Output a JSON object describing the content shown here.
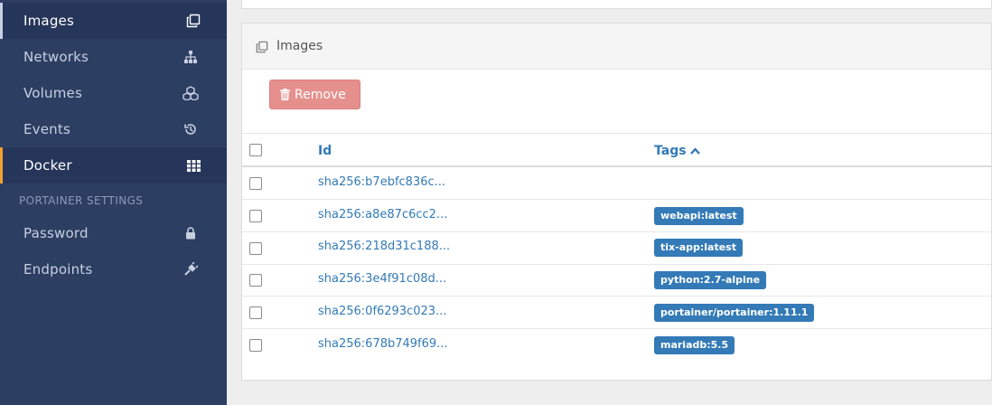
{
  "sidebar": {
    "items": [
      {
        "label": "Images",
        "icon": "clone-icon"
      },
      {
        "label": "Networks",
        "icon": "sitemap-icon"
      },
      {
        "label": "Volumes",
        "icon": "cubes-icon"
      },
      {
        "label": "Events",
        "icon": "history-icon"
      },
      {
        "label": "Docker",
        "icon": "grid-icon"
      }
    ],
    "section_title": "PORTAINER SETTINGS",
    "settings_items": [
      {
        "label": "Password",
        "icon": "lock-icon"
      },
      {
        "label": "Endpoints",
        "icon": "plug-icon"
      }
    ]
  },
  "panel": {
    "title": "Images",
    "remove_label": "Remove",
    "columns": {
      "id": "Id",
      "tags": "Tags"
    },
    "rows": [
      {
        "id": "sha256:b7ebfc836c...",
        "tag": ""
      },
      {
        "id": "sha256:a8e87c6cc2...",
        "tag": "webapi:latest"
      },
      {
        "id": "sha256:218d31c188...",
        "tag": "tix-app:latest"
      },
      {
        "id": "sha256:3e4f91c08d...",
        "tag": "python:2.7-alpine"
      },
      {
        "id": "sha256:0f6293c023...",
        "tag": "portainer/portainer:1.11.1"
      },
      {
        "id": "sha256:678b749f69...",
        "tag": "mariadb:5.5"
      }
    ]
  },
  "colors": {
    "sidebar_bg": "#2d3e63",
    "accent_link": "#337ab7",
    "danger_button": "#e6908d",
    "docker_marker": "#f0a030"
  }
}
